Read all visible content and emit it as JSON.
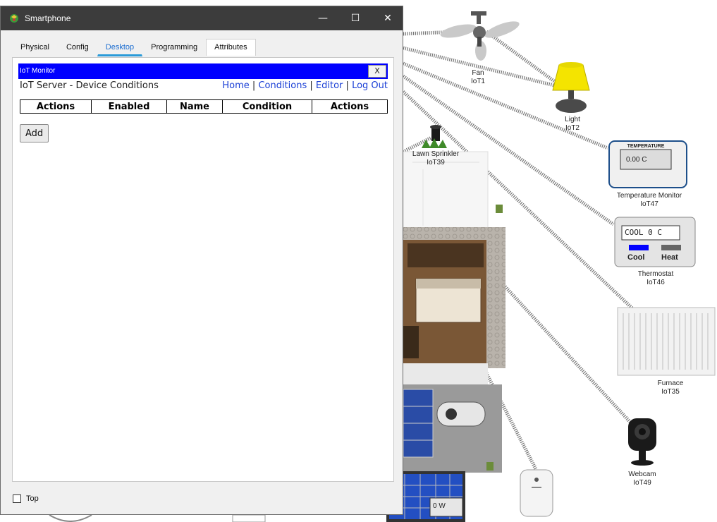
{
  "window": {
    "title": "Smartphone",
    "controls": {
      "minimize": "—",
      "maximize": "☐",
      "close": "✕"
    },
    "tabs": [
      "Physical",
      "Config",
      "Desktop",
      "Programming",
      "Attributes"
    ],
    "active_tab": "Desktop",
    "top_checkbox_label": "Top"
  },
  "iot_app": {
    "titlebar": "IoT Monitor",
    "close_label": "X",
    "subtitle": "IoT Server - Device Conditions",
    "nav": {
      "home": "Home",
      "conditions": "Conditions",
      "editor": "Editor",
      "logout": "Log Out",
      "separator": "|"
    },
    "table_headers": [
      "Actions",
      "Enabled",
      "Name",
      "Condition",
      "Actions"
    ],
    "add_button": "Add"
  },
  "devices": {
    "fan": {
      "name": "Fan",
      "id": "IoT1"
    },
    "light": {
      "name": "Light",
      "id": "IoT2"
    },
    "lawn_sprinkler": {
      "name": "Lawn Sprinkler",
      "id": "IoT39"
    },
    "temperature_monitor": {
      "name": "Temperature Monitor",
      "id": "IoT47",
      "header": "TEMPERATURE",
      "reading": "0.00 C"
    },
    "thermostat": {
      "name": "Thermostat",
      "id": "IoT46",
      "display": "COOL 0 C",
      "cool_label": "Cool",
      "heat_label": "Heat"
    },
    "furnace": {
      "name": "Furnace",
      "id": "IoT35"
    },
    "webcam": {
      "name": "Webcam",
      "id": "IoT49"
    },
    "solar_meter": {
      "reading": "0 W"
    }
  },
  "colors": {
    "titlebar": "#3c3c3c",
    "iot_bar": "#0000ff",
    "tab_active": "#2a9ad8",
    "link": "#1a3fd6",
    "cool": "#0000ff",
    "heat": "#666666"
  }
}
